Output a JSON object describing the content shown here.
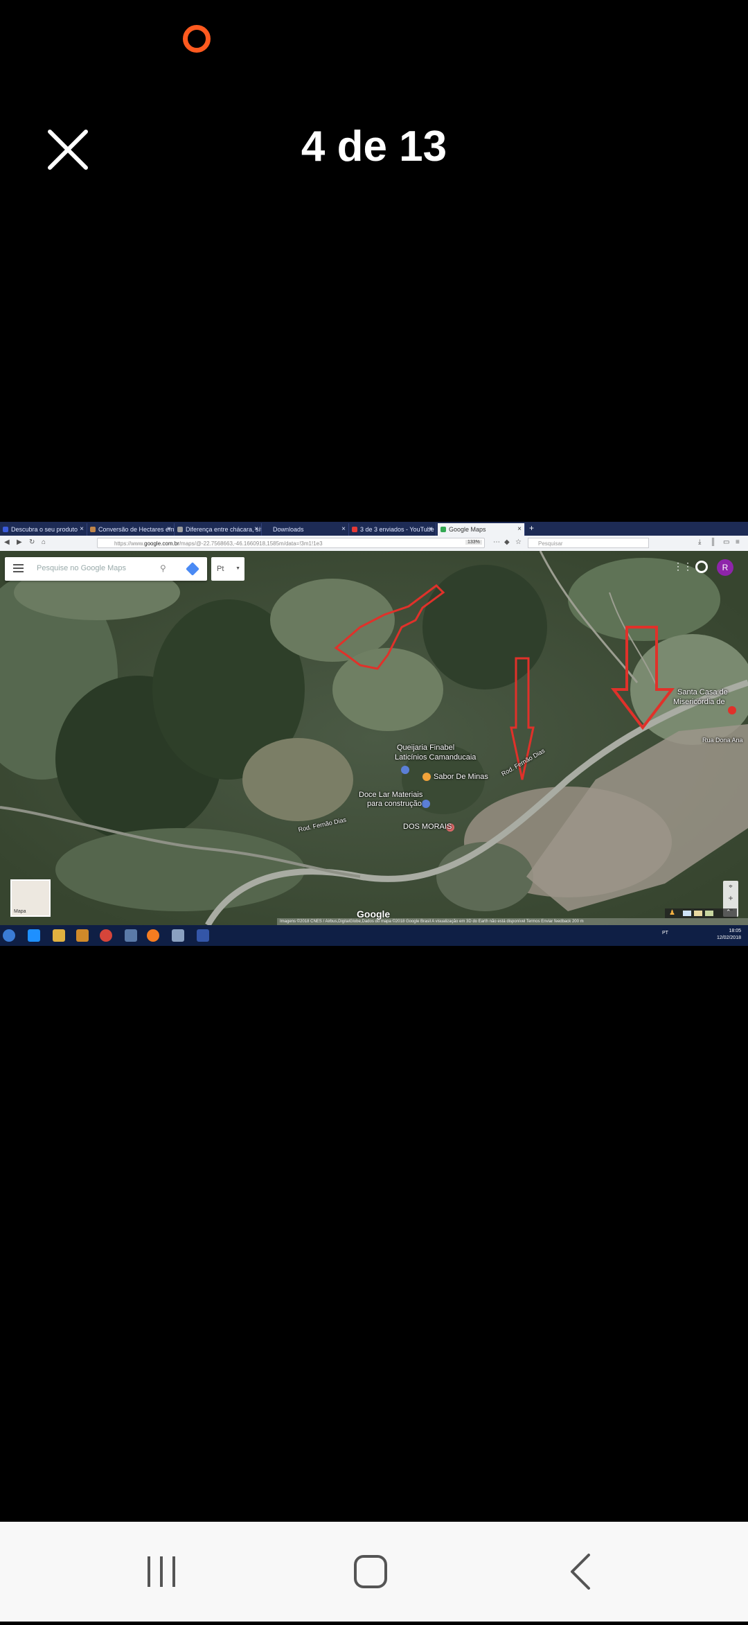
{
  "viewer": {
    "counter": "4 de 13"
  },
  "photo": {
    "tabs": [
      {
        "label": "Descubra o seu produto",
        "color": "#3b5bdb"
      },
      {
        "label": "Conversão de Hectares em M...",
        "color": "#c0854a"
      },
      {
        "label": "Diferença entre chácara, sítio...",
        "color": "#9e9e9e"
      },
      {
        "label": "Downloads",
        "color": "#1d2b55"
      },
      {
        "label": "3 de 3 enviados - YouTube",
        "color": "#e53935"
      },
      {
        "label": "Google Maps",
        "color": "#34a853"
      }
    ],
    "url_prefix": "https://www.",
    "url_domain": "google.com.br",
    "url_rest": "/maps/@-22.7568663,-46.1660918,1585m/data=!3m1!1e3",
    "zoom": "133%",
    "search_placeholder": "Pesquisar",
    "map": {
      "search_placeholder": "Pesquise no Google Maps",
      "language": "Pt",
      "avatar_letter": "R",
      "layer_label": "Mapa",
      "labels": {
        "queijaria": "Queijaria Finabel",
        "laticinios": "Laticínios Camanducaia",
        "sabor": "Sabor De Minas",
        "doce_lar": "Doce Lar Materiais",
        "construcao": "para construção",
        "morais": "DOS MORAIS",
        "santa_casa": "Santa Casa de",
        "misericordia": "Misericórdia de",
        "rod1": "Rod. Fernão Dias",
        "rod2": "Rod. Fernão Dias",
        "rua": "Rua Dona Ana"
      },
      "google_logo": "Google",
      "footer": "Imagens ©2018 CNES / Airbus,DigitalGlobe,Dados do mapa ©2018 Google    Brasil    A visualização em 3D do Earth não está disponível    Termos    Enviar feedback    200 m"
    },
    "taskbar_clock": "18:05",
    "taskbar_date": "12/02/2018",
    "taskbar_lang": "PT"
  }
}
